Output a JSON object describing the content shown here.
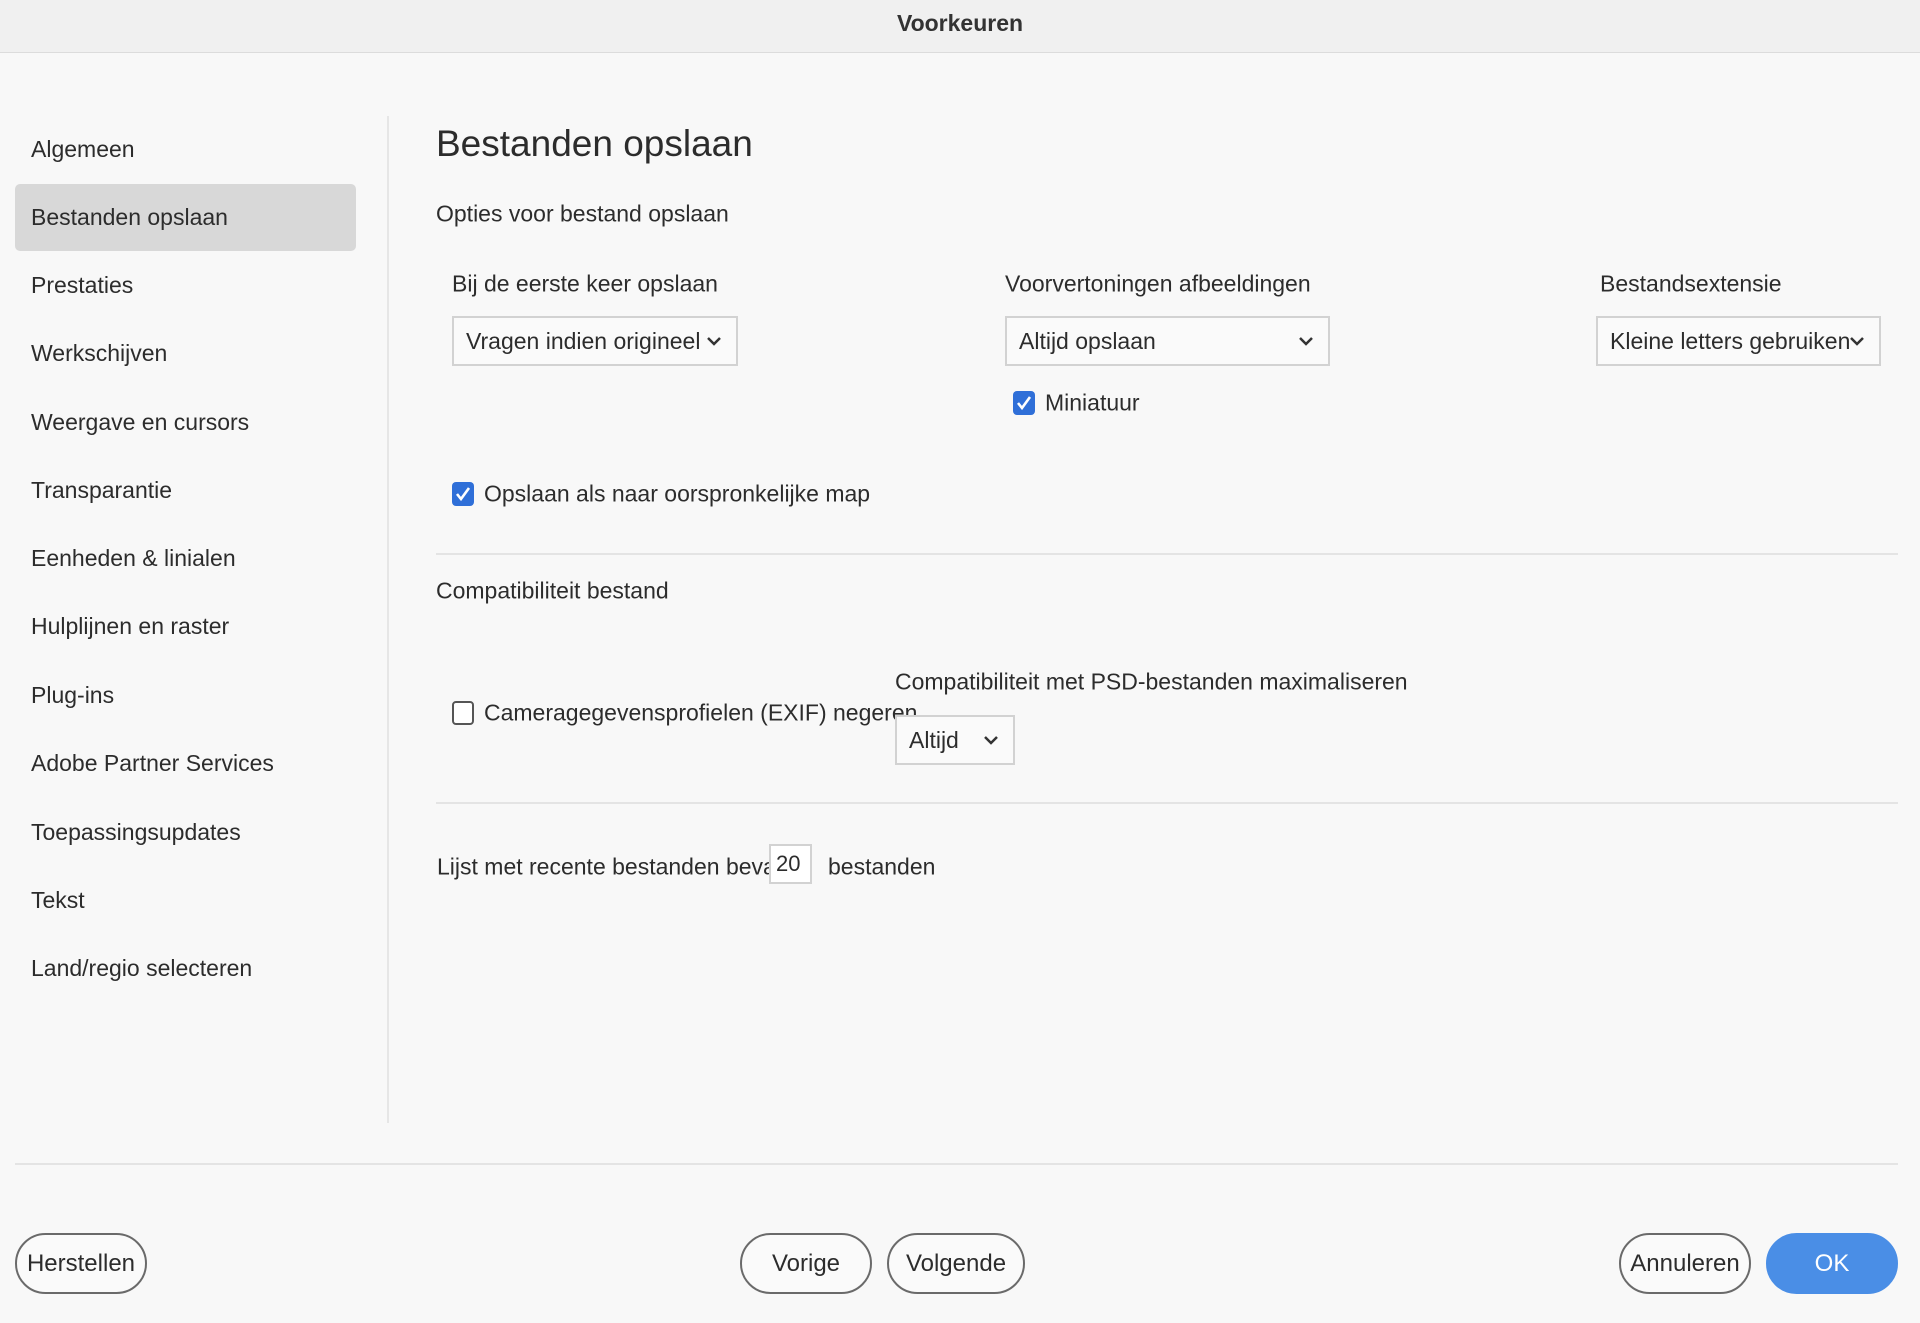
{
  "window": {
    "title": "Voorkeuren"
  },
  "sidebar": {
    "items": [
      {
        "label": "Algemeen"
      },
      {
        "label": "Bestanden opslaan",
        "selected": true
      },
      {
        "label": "Prestaties"
      },
      {
        "label": "Werkschijven"
      },
      {
        "label": "Weergave en cursors"
      },
      {
        "label": "Transparantie"
      },
      {
        "label": "Eenheden & linialen"
      },
      {
        "label": "Hulplijnen en raster"
      },
      {
        "label": "Plug-ins"
      },
      {
        "label": "Adobe Partner Services"
      },
      {
        "label": "Toepassingsupdates"
      },
      {
        "label": "Tekst"
      },
      {
        "label": "Land/regio selecteren"
      }
    ]
  },
  "main": {
    "title": "Bestanden opslaan",
    "save_options": {
      "heading": "Opties voor bestand opslaan",
      "first_save": {
        "label": "Bij de eerste keer opslaan",
        "value": "Vragen indien origineel"
      },
      "previews": {
        "label": "Voorvertoningen afbeeldingen",
        "value": "Altijd opslaan"
      },
      "thumbnail": {
        "label": "Miniatuur",
        "checked": true
      },
      "extension": {
        "label": "Bestandsextensie",
        "value": "Kleine letters gebruiken"
      },
      "save_as_original": {
        "label": "Opslaan als naar oorspronkelijke map",
        "checked": true
      }
    },
    "compat": {
      "heading": "Compatibiliteit bestand",
      "exif": {
        "label": "Cameragegevensprofielen (EXIF) negeren",
        "checked": false
      },
      "psd": {
        "label": "Compatibiliteit met PSD-bestanden maximaliseren",
        "value": "Altijd"
      }
    },
    "recent": {
      "prefix": "Lijst met recente bestanden bevat",
      "value": "20",
      "suffix": "bestanden"
    }
  },
  "footer": {
    "reset": "Herstellen",
    "prev": "Vorige",
    "next": "Volgende",
    "cancel": "Annuleren",
    "ok": "OK"
  },
  "colors": {
    "accent": "#4a8ee6",
    "checkbox": "#2f6fd8"
  }
}
